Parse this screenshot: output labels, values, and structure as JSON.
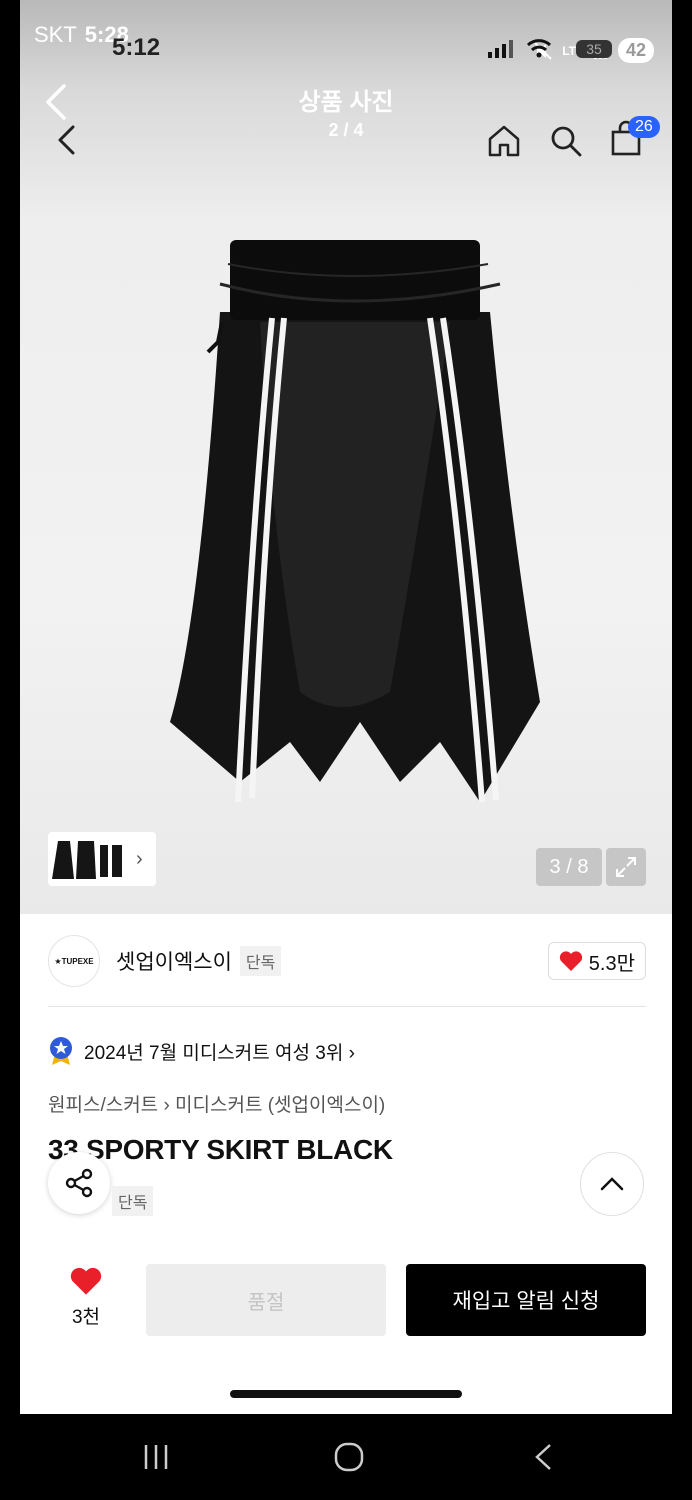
{
  "status_bar": {
    "carrier": "SKT",
    "time": "5:28",
    "lte": "LTE",
    "badge": "42"
  },
  "inner_status": {
    "time": "5:12",
    "battery": "35"
  },
  "header": {
    "title": "상품 사진",
    "photo_index": "2 / 4",
    "cart_count": "26"
  },
  "gallery": {
    "counter": "3 / 8",
    "thumb_chevron": "›"
  },
  "brand": {
    "logo_text": "★TUPEXE",
    "name": "셋업이엑스이",
    "tag": "단독",
    "likes": "5.3만"
  },
  "ranking": {
    "text": "2024년 7월 미디스커트 여성 3위 ›"
  },
  "breadcrumb": "원피스/스커트 › 미디스커트 (셋업이엑스이)",
  "product": {
    "name": "33 SPORTY SKIRT BLACK",
    "tag": "단독"
  },
  "actions": {
    "wish_count": "3천",
    "soldout_label": "품절",
    "notify_label": "재입고 알림 신청"
  },
  "colors": {
    "accent_blue": "#2962ff",
    "heart_red": "#e8202a",
    "notify_bg": "#000000"
  },
  "icons": [
    "back-icon",
    "home-icon",
    "search-icon",
    "cart-icon",
    "expand-icon",
    "share-icon",
    "chevron-up-icon",
    "heart-icon",
    "ranking-badge-icon",
    "recent-apps-icon",
    "home-nav-icon",
    "back-nav-icon"
  ]
}
